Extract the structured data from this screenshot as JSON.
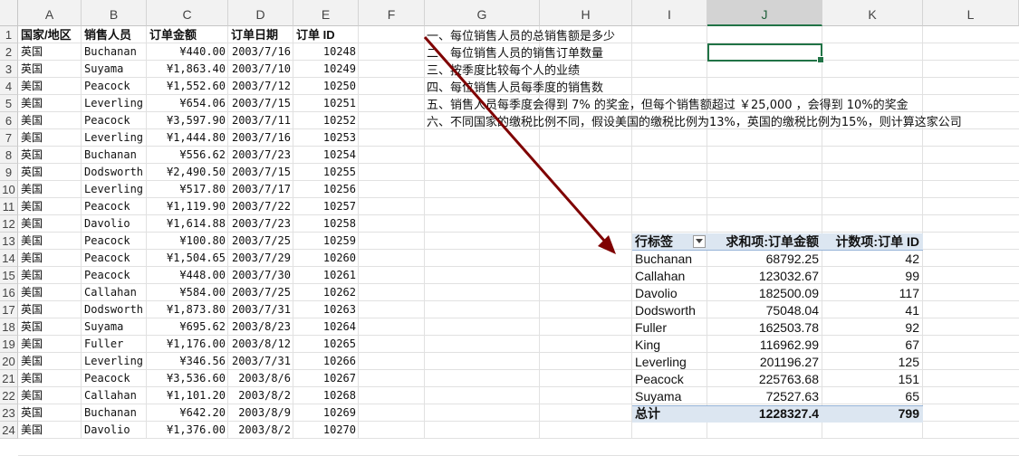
{
  "columns": [
    "A",
    "B",
    "C",
    "D",
    "E",
    "F",
    "G",
    "H",
    "I",
    "J",
    "K",
    "L"
  ],
  "selected_column": "J",
  "rows": [
    1,
    2,
    3,
    4,
    5,
    6,
    7,
    8,
    9,
    10,
    11,
    12,
    13,
    14,
    15,
    16,
    17,
    18,
    19,
    20,
    21,
    22,
    23,
    24
  ],
  "table": {
    "headers": [
      "国家/地区",
      "销售人员",
      "订单金额",
      "订单日期",
      "订单 ID"
    ],
    "records": [
      [
        "英国",
        "Buchanan",
        "¥440.00",
        "2003/7/16",
        "10248"
      ],
      [
        "英国",
        "Suyama",
        "¥1,863.40",
        "2003/7/10",
        "10249"
      ],
      [
        "美国",
        "Peacock",
        "¥1,552.60",
        "2003/7/12",
        "10250"
      ],
      [
        "美国",
        "Leverling",
        "¥654.06",
        "2003/7/15",
        "10251"
      ],
      [
        "美国",
        "Peacock",
        "¥3,597.90",
        "2003/7/11",
        "10252"
      ],
      [
        "美国",
        "Leverling",
        "¥1,444.80",
        "2003/7/16",
        "10253"
      ],
      [
        "英国",
        "Buchanan",
        "¥556.62",
        "2003/7/23",
        "10254"
      ],
      [
        "英国",
        "Dodsworth",
        "¥2,490.50",
        "2003/7/15",
        "10255"
      ],
      [
        "美国",
        "Leverling",
        "¥517.80",
        "2003/7/17",
        "10256"
      ],
      [
        "美国",
        "Peacock",
        "¥1,119.90",
        "2003/7/22",
        "10257"
      ],
      [
        "美国",
        "Davolio",
        "¥1,614.88",
        "2003/7/23",
        "10258"
      ],
      [
        "美国",
        "Peacock",
        "¥100.80",
        "2003/7/25",
        "10259"
      ],
      [
        "美国",
        "Peacock",
        "¥1,504.65",
        "2003/7/29",
        "10260"
      ],
      [
        "美国",
        "Peacock",
        "¥448.00",
        "2003/7/30",
        "10261"
      ],
      [
        "美国",
        "Callahan",
        "¥584.00",
        "2003/7/25",
        "10262"
      ],
      [
        "英国",
        "Dodsworth",
        "¥1,873.80",
        "2003/7/31",
        "10263"
      ],
      [
        "英国",
        "Suyama",
        "¥695.62",
        "2003/8/23",
        "10264"
      ],
      [
        "美国",
        "Fuller",
        "¥1,176.00",
        "2003/8/12",
        "10265"
      ],
      [
        "美国",
        "Leverling",
        "¥346.56",
        "2003/7/31",
        "10266"
      ],
      [
        "美国",
        "Peacock",
        "¥3,536.60",
        "2003/8/6",
        "10267"
      ],
      [
        "美国",
        "Callahan",
        "¥1,101.20",
        "2003/8/2",
        "10268"
      ],
      [
        "英国",
        "Buchanan",
        "¥642.20",
        "2003/8/9",
        "10269"
      ],
      [
        "美国",
        "Davolio",
        "¥1,376.00",
        "2003/8/2",
        "10270"
      ]
    ]
  },
  "notes": [
    "一、每位销售人员的总销售额是多少",
    "二、每位销售人员的销售订单数量",
    "三、按季度比较每个人的业绩",
    "四、每位销售人员每季度的销售数",
    "五、销售人员每季度会得到 7% 的奖金，但每个销售额超过 ￥25,000 ，会得到 10%的奖金",
    "六、不同国家的缴税比例不同，假设美国的缴税比例为13%，英国的缴税比例为15%，则计算这家公司"
  ],
  "pivot": {
    "headers": [
      "行标签",
      "求和项:订单金额",
      "计数项:订单 ID"
    ],
    "rows": [
      [
        "Buchanan",
        "68792.25",
        "42"
      ],
      [
        "Callahan",
        "123032.67",
        "99"
      ],
      [
        "Davolio",
        "182500.09",
        "117"
      ],
      [
        "Dodsworth",
        "75048.04",
        "41"
      ],
      [
        "Fuller",
        "162503.78",
        "92"
      ],
      [
        "King",
        "116962.99",
        "67"
      ],
      [
        "Leverling",
        "201196.27",
        "125"
      ],
      [
        "Peacock",
        "225763.68",
        "151"
      ],
      [
        "Suyama",
        "72527.63",
        "65"
      ]
    ],
    "total": [
      "总计",
      "1228327.4",
      "799"
    ]
  },
  "colors": {
    "arrow": "#7f0000",
    "pivot_header": "#dce6f1",
    "selection": "#217346"
  }
}
